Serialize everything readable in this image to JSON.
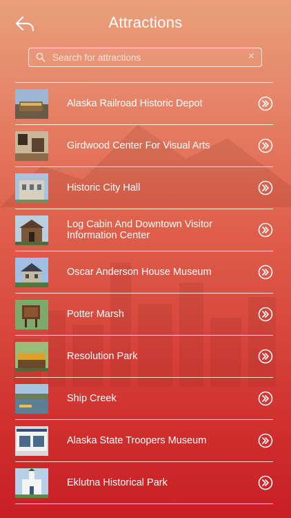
{
  "header": {
    "title": "Attractions"
  },
  "search": {
    "placeholder": "Search for attractions"
  },
  "list": [
    {
      "label": "Alaska Railroad Historic Depot"
    },
    {
      "label": "Girdwood Center For Visual Arts"
    },
    {
      "label": "Historic City Hall"
    },
    {
      "label": "Log Cabin And Downtown Visitor Information Center"
    },
    {
      "label": "Oscar Anderson House Museum"
    },
    {
      "label": "Potter Marsh"
    },
    {
      "label": "Resolution Park"
    },
    {
      "label": "Ship Creek"
    },
    {
      "label": "Alaska State Troopers Museum"
    },
    {
      "label": "Eklutna Historical Park"
    }
  ]
}
